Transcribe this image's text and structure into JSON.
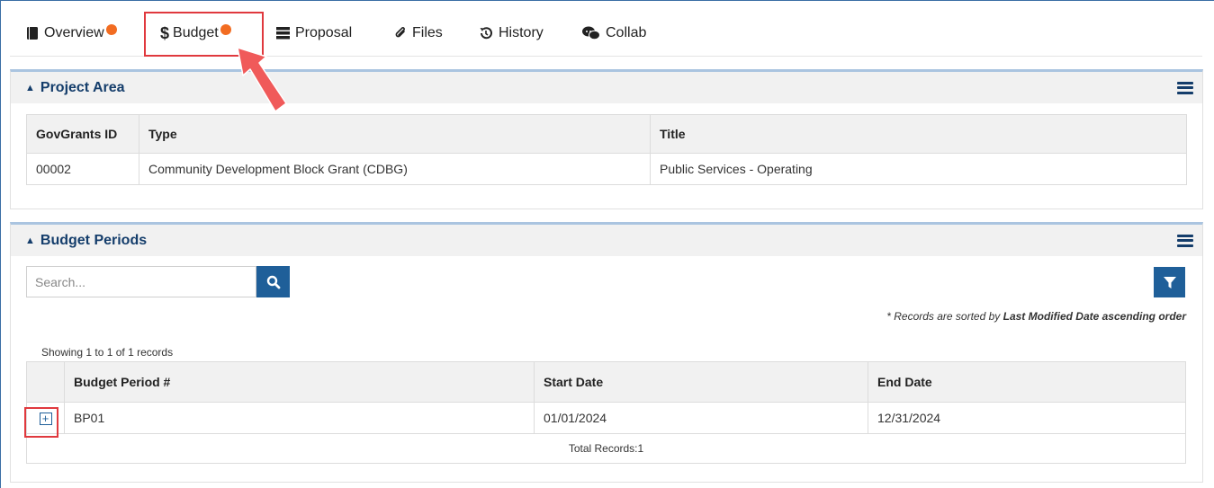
{
  "tabs": [
    {
      "label": "Overview",
      "icon": "book-icon",
      "has_dot": true
    },
    {
      "label": "Budget",
      "icon": "dollar-icon",
      "has_dot": true
    },
    {
      "label": "Proposal",
      "icon": "server-icon",
      "has_dot": false
    },
    {
      "label": "Files",
      "icon": "paperclip-icon",
      "has_dot": false
    },
    {
      "label": "History",
      "icon": "history-icon",
      "has_dot": false
    },
    {
      "label": "Collab",
      "icon": "chat-icon",
      "has_dot": false
    }
  ],
  "project_area": {
    "title": "Project Area",
    "columns": [
      "GovGrants ID",
      "Type",
      "Title"
    ],
    "rows": [
      [
        "00002",
        "Community Development Block Grant (CDBG)",
        "Public Services - Operating"
      ]
    ]
  },
  "budget_periods": {
    "title": "Budget Periods",
    "search_placeholder": "Search...",
    "sort_note_prefix": "* Records are sorted by ",
    "sort_note_field": "Last Modified Date ascending order",
    "showing": "Showing 1 to 1 of 1 records",
    "columns": [
      "Budget Period #",
      "Start Date",
      "End Date"
    ],
    "rows": [
      [
        "BP01",
        "01/01/2024",
        "12/31/2024"
      ]
    ],
    "total": "Total Records:1"
  },
  "colors": {
    "accent": "#1f5f99",
    "title": "#143d6b",
    "dot": "#f26c21",
    "highlight": "#e0393e"
  }
}
